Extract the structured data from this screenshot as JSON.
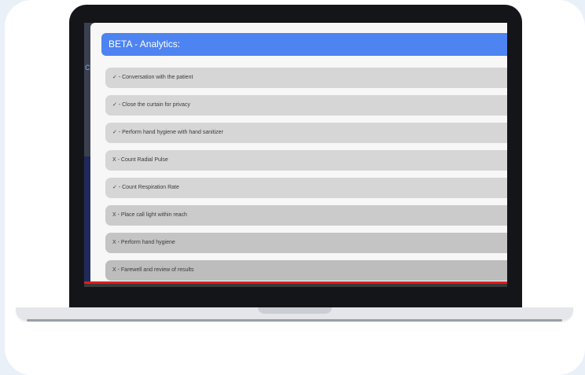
{
  "analytics": {
    "title": "BETA - Analytics:",
    "items": [
      {
        "mark": "✓",
        "text": "Conversation with the patient"
      },
      {
        "mark": "✓",
        "text": "Close the curtain for privacy"
      },
      {
        "mark": "✓",
        "text": "Perform hand hygiene with hand sanitizer"
      },
      {
        "mark": "X",
        "text": "Count Radial Pulse"
      },
      {
        "mark": "✓",
        "text": "Count Respiration Rate"
      },
      {
        "mark": "X",
        "text": "Place call light within reach"
      },
      {
        "mark": "X",
        "text": "Perform hand hygiene"
      },
      {
        "mark": "X",
        "text": "Farewell and review of results"
      }
    ],
    "background_letter": "C"
  },
  "colors": {
    "header": "#4e84f1",
    "progress": "#e11c1c"
  }
}
